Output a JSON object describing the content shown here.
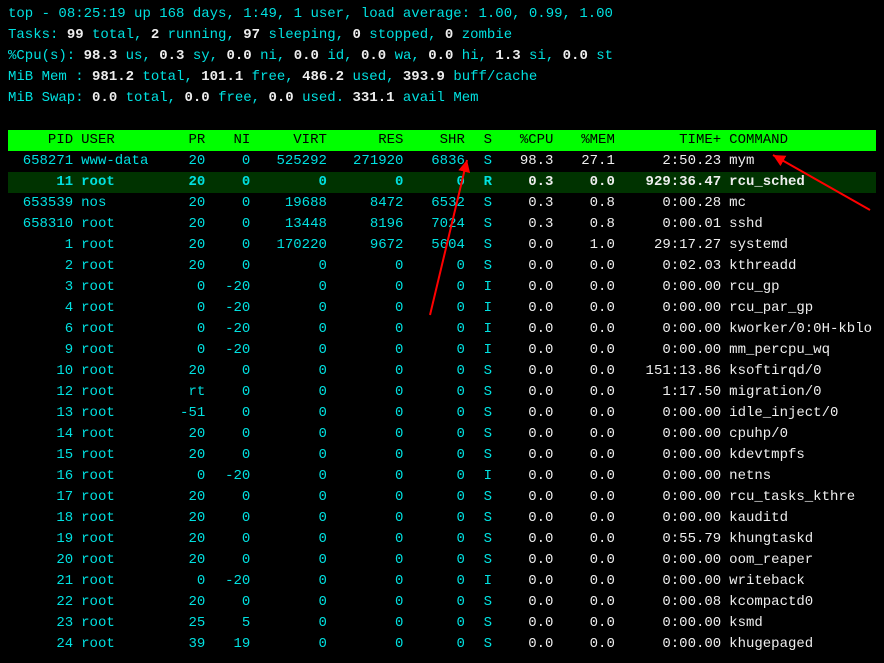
{
  "summary": {
    "line1_a": "top - ",
    "time": "08:25:19",
    "line1_b": " up 168 days,  1:49,  1 user,  load average: 1.00, 0.99, 1.00",
    "tasks_label": "Tasks:  ",
    "tasks_total": "99",
    "tasks_total_u": " total,    ",
    "tasks_run": "2",
    "tasks_run_u": " running,   ",
    "tasks_sleep": "97",
    "tasks_sleep_u": " sleeping,   ",
    "tasks_stop": "0",
    "tasks_stop_u": " stopped,   ",
    "tasks_zomb": "0",
    "tasks_zomb_u": " zombie",
    "cpu_label": "%Cpu(s): ",
    "cpu_us": "98.3",
    "cpu_us_u": " us,   ",
    "cpu_sy": "0.3",
    "cpu_sy_u": " sy,   ",
    "cpu_ni": "0.0",
    "cpu_ni_u": " ni,   ",
    "cpu_id": "0.0",
    "cpu_id_u": " id,   ",
    "cpu_wa": "0.0",
    "cpu_wa_u": " wa,   ",
    "cpu_hi": "0.0",
    "cpu_hi_u": " hi,   ",
    "cpu_si": "1.3",
    "cpu_si_u": " si,   ",
    "cpu_st": "0.0",
    "cpu_st_u": " st",
    "mem_label": "MiB Mem :   ",
    "mem_total": "981.2",
    "mem_total_u": " total,    ",
    "mem_free": "101.1",
    "mem_free_u": " free,    ",
    "mem_used": "486.2",
    "mem_used_u": " used,    ",
    "mem_buf": "393.9",
    "mem_buf_u": " buff/cache",
    "swap_label": "MiB Swap:     ",
    "swap_total": "0.0",
    "swap_total_u": " total,      ",
    "swap_free": "0.0",
    "swap_free_u": " free,      ",
    "swap_used": "0.0",
    "swap_used_u": " used.    ",
    "swap_avail": "331.1",
    "swap_avail_u": " avail Mem"
  },
  "headers": [
    "PID",
    "USER",
    "PR",
    "NI",
    "VIRT",
    "RES",
    "SHR",
    "S",
    "%CPU",
    "%MEM",
    "TIME+",
    "COMMAND"
  ],
  "rows": [
    {
      "pid": "658271",
      "user": "www-data",
      "pr": "20",
      "ni": "0",
      "virt": "525292",
      "res": "271920",
      "shr": "6836",
      "s": "S",
      "cpu": "98.3",
      "mem": "27.1",
      "time": "2:50.23",
      "cmd": "mym",
      "hl": false
    },
    {
      "pid": "11",
      "user": "root",
      "pr": "20",
      "ni": "0",
      "virt": "0",
      "res": "0",
      "shr": "0",
      "s": "R",
      "cpu": "0.3",
      "mem": "0.0",
      "time": "929:36.47",
      "cmd": "rcu_sched",
      "hl": true
    },
    {
      "pid": "653539",
      "user": "nos",
      "pr": "20",
      "ni": "0",
      "virt": "19688",
      "res": "8472",
      "shr": "6532",
      "s": "S",
      "cpu": "0.3",
      "mem": "0.8",
      "time": "0:00.28",
      "cmd": "mc",
      "hl": false
    },
    {
      "pid": "658310",
      "user": "root",
      "pr": "20",
      "ni": "0",
      "virt": "13448",
      "res": "8196",
      "shr": "7024",
      "s": "S",
      "cpu": "0.3",
      "mem": "0.8",
      "time": "0:00.01",
      "cmd": "sshd",
      "hl": false
    },
    {
      "pid": "1",
      "user": "root",
      "pr": "20",
      "ni": "0",
      "virt": "170220",
      "res": "9672",
      "shr": "5604",
      "s": "S",
      "cpu": "0.0",
      "mem": "1.0",
      "time": "29:17.27",
      "cmd": "systemd",
      "hl": false
    },
    {
      "pid": "2",
      "user": "root",
      "pr": "20",
      "ni": "0",
      "virt": "0",
      "res": "0",
      "shr": "0",
      "s": "S",
      "cpu": "0.0",
      "mem": "0.0",
      "time": "0:02.03",
      "cmd": "kthreadd",
      "hl": false
    },
    {
      "pid": "3",
      "user": "root",
      "pr": "0",
      "ni": "-20",
      "virt": "0",
      "res": "0",
      "shr": "0",
      "s": "I",
      "cpu": "0.0",
      "mem": "0.0",
      "time": "0:00.00",
      "cmd": "rcu_gp",
      "hl": false
    },
    {
      "pid": "4",
      "user": "root",
      "pr": "0",
      "ni": "-20",
      "virt": "0",
      "res": "0",
      "shr": "0",
      "s": "I",
      "cpu": "0.0",
      "mem": "0.0",
      "time": "0:00.00",
      "cmd": "rcu_par_gp",
      "hl": false
    },
    {
      "pid": "6",
      "user": "root",
      "pr": "0",
      "ni": "-20",
      "virt": "0",
      "res": "0",
      "shr": "0",
      "s": "I",
      "cpu": "0.0",
      "mem": "0.0",
      "time": "0:00.00",
      "cmd": "kworker/0:0H-kblo",
      "hl": false
    },
    {
      "pid": "9",
      "user": "root",
      "pr": "0",
      "ni": "-20",
      "virt": "0",
      "res": "0",
      "shr": "0",
      "s": "I",
      "cpu": "0.0",
      "mem": "0.0",
      "time": "0:00.00",
      "cmd": "mm_percpu_wq",
      "hl": false
    },
    {
      "pid": "10",
      "user": "root",
      "pr": "20",
      "ni": "0",
      "virt": "0",
      "res": "0",
      "shr": "0",
      "s": "S",
      "cpu": "0.0",
      "mem": "0.0",
      "time": "151:13.86",
      "cmd": "ksoftirqd/0",
      "hl": false
    },
    {
      "pid": "12",
      "user": "root",
      "pr": "rt",
      "ni": "0",
      "virt": "0",
      "res": "0",
      "shr": "0",
      "s": "S",
      "cpu": "0.0",
      "mem": "0.0",
      "time": "1:17.50",
      "cmd": "migration/0",
      "hl": false
    },
    {
      "pid": "13",
      "user": "root",
      "pr": "-51",
      "ni": "0",
      "virt": "0",
      "res": "0",
      "shr": "0",
      "s": "S",
      "cpu": "0.0",
      "mem": "0.0",
      "time": "0:00.00",
      "cmd": "idle_inject/0",
      "hl": false
    },
    {
      "pid": "14",
      "user": "root",
      "pr": "20",
      "ni": "0",
      "virt": "0",
      "res": "0",
      "shr": "0",
      "s": "S",
      "cpu": "0.0",
      "mem": "0.0",
      "time": "0:00.00",
      "cmd": "cpuhp/0",
      "hl": false
    },
    {
      "pid": "15",
      "user": "root",
      "pr": "20",
      "ni": "0",
      "virt": "0",
      "res": "0",
      "shr": "0",
      "s": "S",
      "cpu": "0.0",
      "mem": "0.0",
      "time": "0:00.00",
      "cmd": "kdevtmpfs",
      "hl": false
    },
    {
      "pid": "16",
      "user": "root",
      "pr": "0",
      "ni": "-20",
      "virt": "0",
      "res": "0",
      "shr": "0",
      "s": "I",
      "cpu": "0.0",
      "mem": "0.0",
      "time": "0:00.00",
      "cmd": "netns",
      "hl": false
    },
    {
      "pid": "17",
      "user": "root",
      "pr": "20",
      "ni": "0",
      "virt": "0",
      "res": "0",
      "shr": "0",
      "s": "S",
      "cpu": "0.0",
      "mem": "0.0",
      "time": "0:00.00",
      "cmd": "rcu_tasks_kthre",
      "hl": false
    },
    {
      "pid": "18",
      "user": "root",
      "pr": "20",
      "ni": "0",
      "virt": "0",
      "res": "0",
      "shr": "0",
      "s": "S",
      "cpu": "0.0",
      "mem": "0.0",
      "time": "0:00.00",
      "cmd": "kauditd",
      "hl": false
    },
    {
      "pid": "19",
      "user": "root",
      "pr": "20",
      "ni": "0",
      "virt": "0",
      "res": "0",
      "shr": "0",
      "s": "S",
      "cpu": "0.0",
      "mem": "0.0",
      "time": "0:55.79",
      "cmd": "khungtaskd",
      "hl": false
    },
    {
      "pid": "20",
      "user": "root",
      "pr": "20",
      "ni": "0",
      "virt": "0",
      "res": "0",
      "shr": "0",
      "s": "S",
      "cpu": "0.0",
      "mem": "0.0",
      "time": "0:00.00",
      "cmd": "oom_reaper",
      "hl": false
    },
    {
      "pid": "21",
      "user": "root",
      "pr": "0",
      "ni": "-20",
      "virt": "0",
      "res": "0",
      "shr": "0",
      "s": "I",
      "cpu": "0.0",
      "mem": "0.0",
      "time": "0:00.00",
      "cmd": "writeback",
      "hl": false
    },
    {
      "pid": "22",
      "user": "root",
      "pr": "20",
      "ni": "0",
      "virt": "0",
      "res": "0",
      "shr": "0",
      "s": "S",
      "cpu": "0.0",
      "mem": "0.0",
      "time": "0:00.08",
      "cmd": "kcompactd0",
      "hl": false
    },
    {
      "pid": "23",
      "user": "root",
      "pr": "25",
      "ni": "5",
      "virt": "0",
      "res": "0",
      "shr": "0",
      "s": "S",
      "cpu": "0.0",
      "mem": "0.0",
      "time": "0:00.00",
      "cmd": "ksmd",
      "hl": false
    },
    {
      "pid": "24",
      "user": "root",
      "pr": "39",
      "ni": "19",
      "virt": "0",
      "res": "0",
      "shr": "0",
      "s": "S",
      "cpu": "0.0",
      "mem": "0.0",
      "time": "0:00.00",
      "cmd": "khugepaged",
      "hl": false
    }
  ]
}
